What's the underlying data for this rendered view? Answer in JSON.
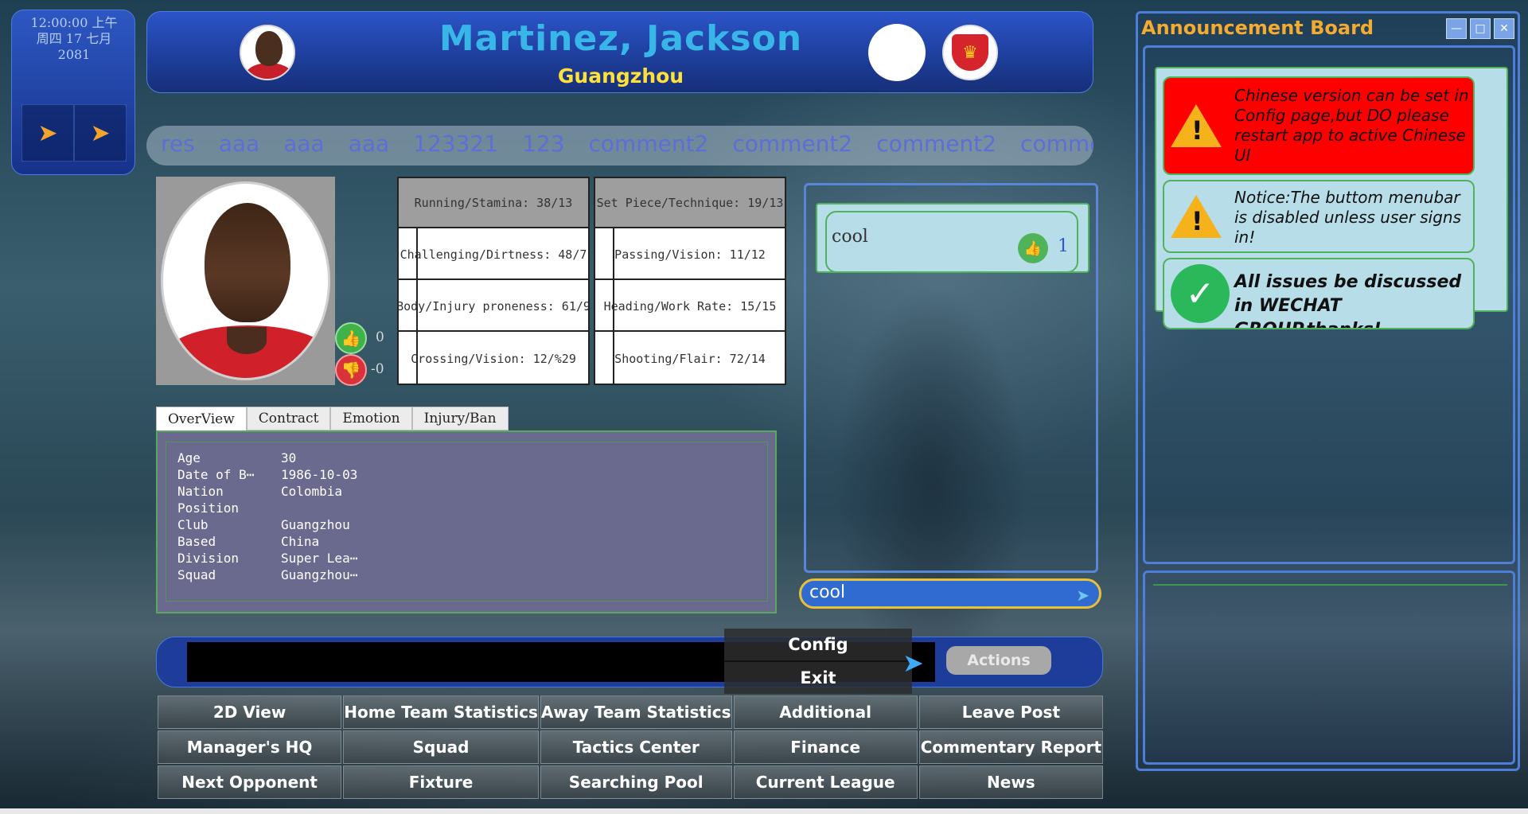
{
  "clock": {
    "time": "12:00:00 上午",
    "date": "周四 17 七月",
    "year": "2081"
  },
  "header": {
    "player_name": "Martinez, Jackson",
    "club": "Guangzhou"
  },
  "ticker": [
    "res",
    "aaa",
    "aaa",
    "aaa",
    "123321",
    "123",
    "comment2",
    "comment2",
    "comment2",
    "comme"
  ],
  "votes": {
    "likes": "0",
    "dislikes": "-0"
  },
  "stats": {
    "left": [
      "Running/Stamina: 38/13",
      "Challenging/Dirtness: 48/7",
      "Body/Injury proneness: 61/9",
      "Crossing/Vision: 12/%29"
    ],
    "right": [
      "Set Piece/Technique: 19/13",
      "Passing/Vision: 11/12",
      "Heading/Work Rate: 15/15",
      "Shooting/Flair: 72/14"
    ]
  },
  "tabs": [
    "OverView",
    "Contract",
    "Emotion",
    "Injury/Ban"
  ],
  "overview": [
    {
      "label": "Age",
      "value": "30"
    },
    {
      "label": "Date of B⋯",
      "value": "1986-10-03"
    },
    {
      "label": "Nation",
      "value": "Colombia"
    },
    {
      "label": "Position",
      "value": ""
    },
    {
      "label": "Club",
      "value": "Guangzhou"
    },
    {
      "label": "Based",
      "value": "China"
    },
    {
      "label": "Division",
      "value": "Super Lea⋯"
    },
    {
      "label": "Squad",
      "value": "Guangzhou⋯"
    }
  ],
  "comments": {
    "items": [
      {
        "text": "cool",
        "likes": "1"
      }
    ],
    "input_value": "cool"
  },
  "announcement": {
    "title": "Announcement Board",
    "items": [
      {
        "text": "Chinese version can be set in Config page,but DO please restart app to active Chinese UI",
        "style": "red",
        "icon": "warning-icon"
      },
      {
        "text": "Notice:The buttom menubar is disabled unless user signs in!",
        "style": "blue",
        "icon": "warning-icon"
      },
      {
        "text": "All issues be discussed in WECHAT GROUP,thanks!",
        "style": "blue",
        "icon": "check-icon"
      }
    ]
  },
  "menu": {
    "config": "Config",
    "exit": "Exit",
    "actions": "Actions"
  },
  "grid_buttons": [
    "2D View",
    "Home Team Statistics",
    "Away Team Statistics",
    "Additional",
    "Leave Post",
    "Manager's HQ",
    "Squad",
    "Tactics Center",
    "Finance",
    "Commentary Report",
    "Next Opponent",
    "Fixture",
    "Searching Pool",
    "Current League",
    "News"
  ],
  "colors": {
    "title_blue": "#39b6e8",
    "club_yellow": "#ffe13a",
    "announce_orange": "#f3ab30",
    "panel_blue": "#1e3d9a"
  }
}
